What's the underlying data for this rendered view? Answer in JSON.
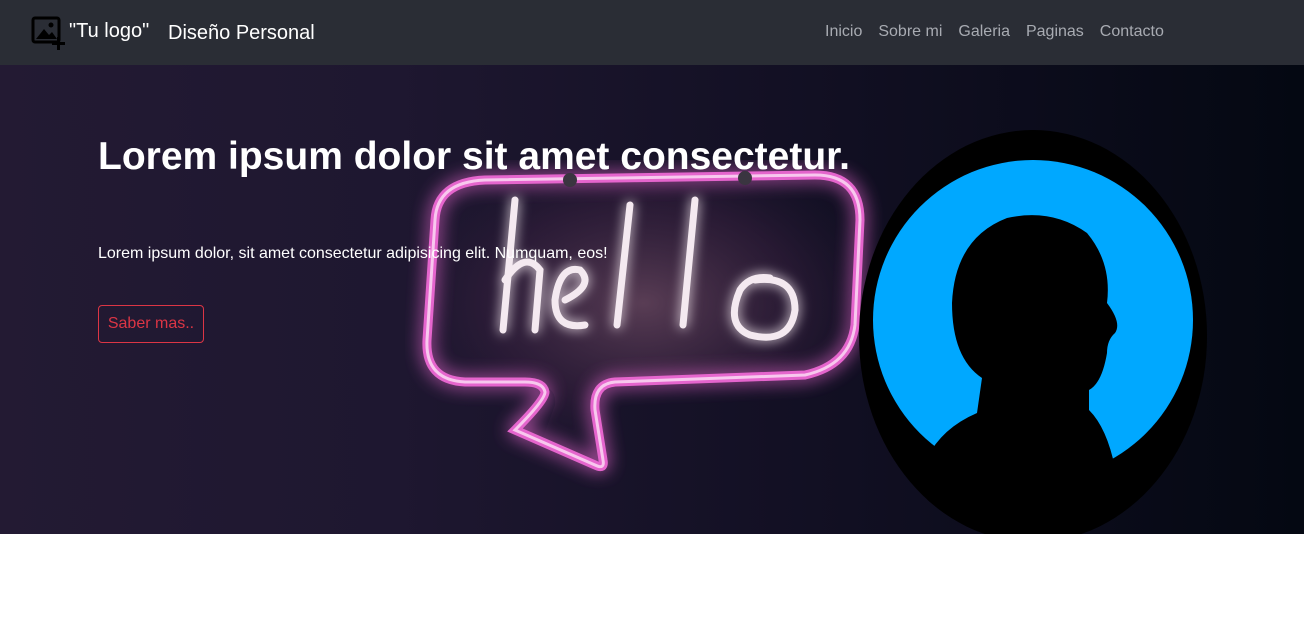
{
  "navbar": {
    "logo_text": "\"Tu logo\"",
    "brand_name": "Diseño Personal",
    "links": [
      "Inicio",
      "Sobre mi",
      "Galeria",
      "Paginas",
      "Contacto"
    ],
    "link_color": "#a8abb2",
    "background": "#2a2d35"
  },
  "hero": {
    "title": "Lorem ipsum dolor sit amet consectetur.",
    "text": "Lorem ipsum dolor, sit amet consectetur adipisicing elit. Numquam, eos!",
    "button_label": "Saber mas..",
    "button_color": "#dc3545",
    "neon_sign_text": "hello"
  },
  "icons": {
    "logo": "add-image-icon"
  },
  "portrait": {
    "circle_color": "#00a8ff"
  }
}
